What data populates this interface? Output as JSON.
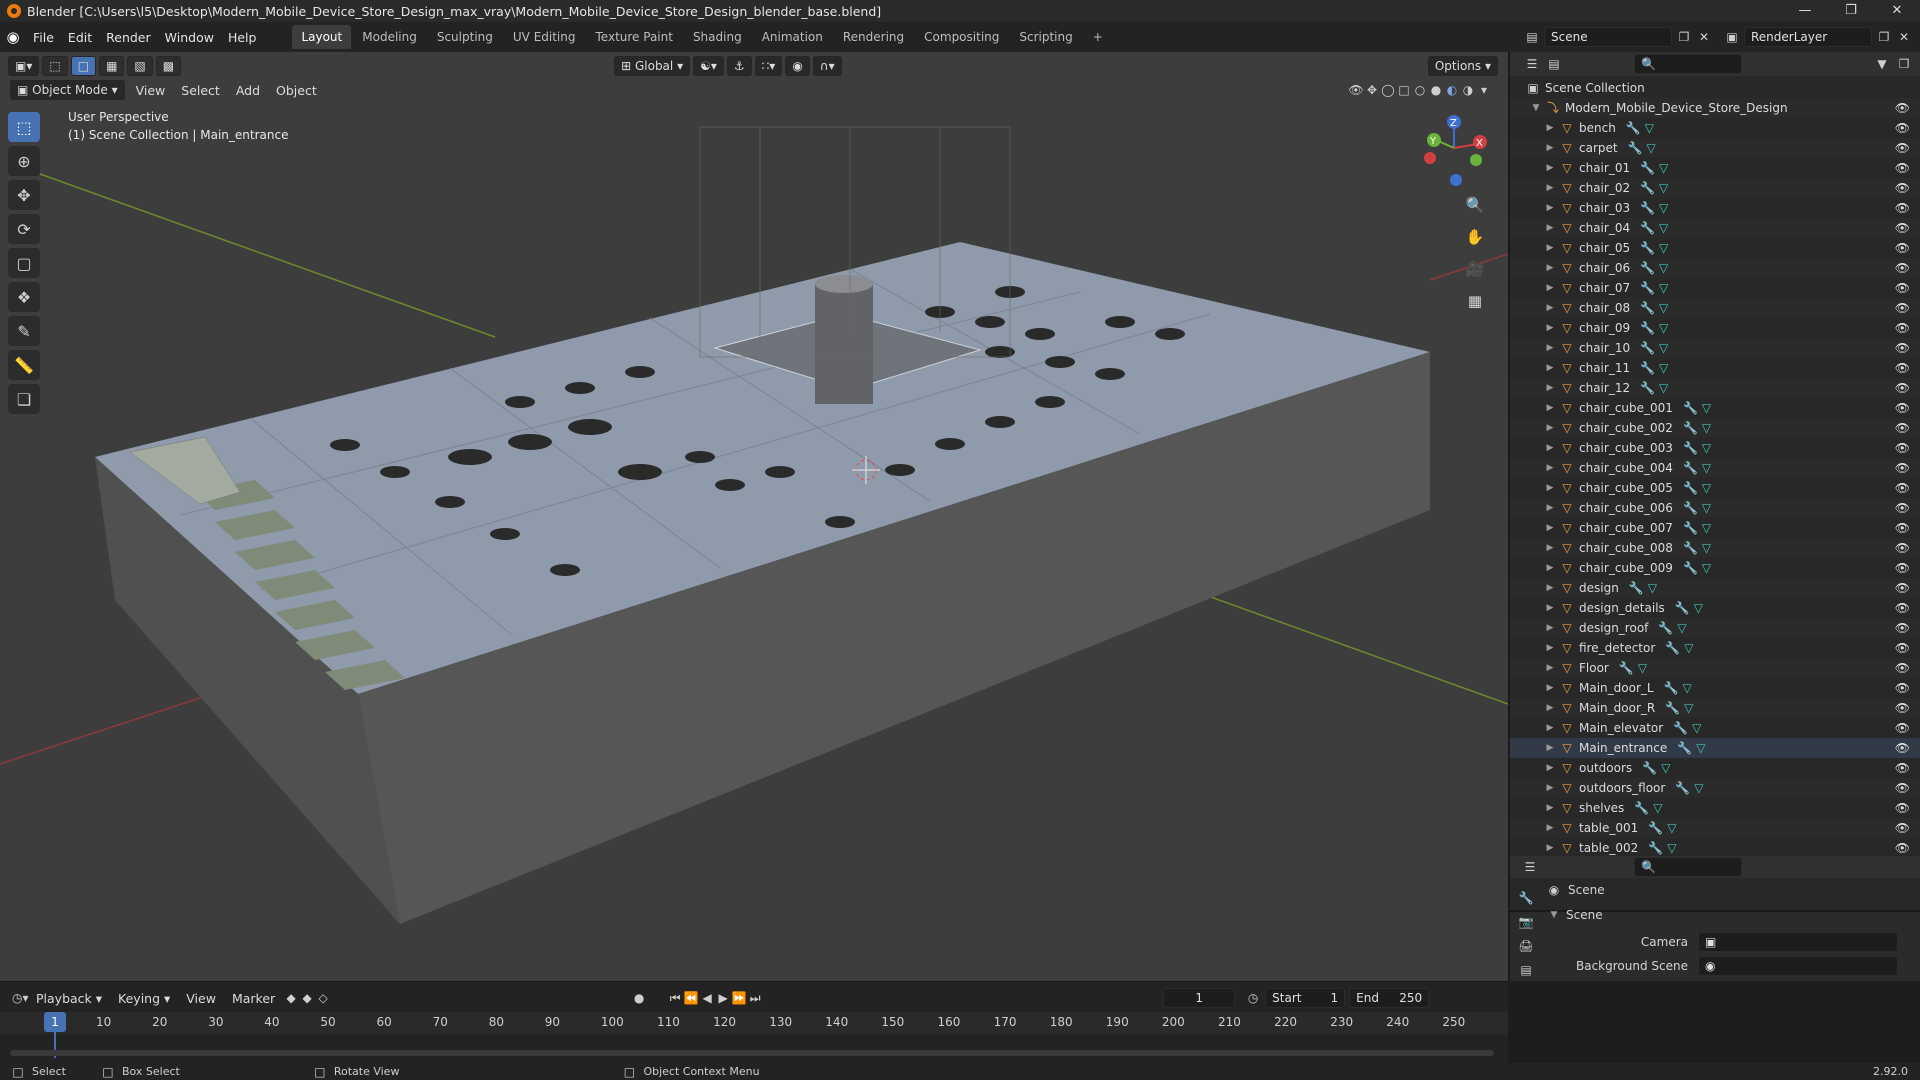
{
  "window": {
    "title": "Blender [C:\\Users\\l5\\Desktop\\Modern_Mobile_Device_Store_Design_max_vray\\Modern_Mobile_Device_Store_Design_blender_base.blend]"
  },
  "menus": [
    "File",
    "Edit",
    "Render",
    "Window",
    "Help"
  ],
  "workspaces": [
    {
      "label": "Layout",
      "active": true
    },
    {
      "label": "Modeling"
    },
    {
      "label": "Sculpting"
    },
    {
      "label": "UV Editing"
    },
    {
      "label": "Texture Paint"
    },
    {
      "label": "Shading"
    },
    {
      "label": "Animation"
    },
    {
      "label": "Rendering"
    },
    {
      "label": "Compositing"
    },
    {
      "label": "Scripting"
    }
  ],
  "scene_field": "Scene",
  "renderlayer_field": "RenderLayer",
  "viewport": {
    "transform_orientation": "Global",
    "options_label": "Options",
    "mode": "Object Mode",
    "header_menus": [
      "View",
      "Select",
      "Add",
      "Object"
    ],
    "perspective_label": "User Perspective",
    "context_label": "(1) Scene Collection | Main_entrance",
    "gizmo": {
      "x": "X",
      "y": "Y",
      "z": "Z"
    }
  },
  "outliner": {
    "root": "Scene Collection",
    "collection": "Modern_Mobile_Device_Store_Design",
    "items": [
      "bench",
      "carpet",
      "chair_01",
      "chair_02",
      "chair_03",
      "chair_04",
      "chair_05",
      "chair_06",
      "chair_07",
      "chair_08",
      "chair_09",
      "chair_10",
      "chair_11",
      "chair_12",
      "chair_cube_001",
      "chair_cube_002",
      "chair_cube_003",
      "chair_cube_004",
      "chair_cube_005",
      "chair_cube_006",
      "chair_cube_007",
      "chair_cube_008",
      "chair_cube_009",
      "design",
      "design_details",
      "design_roof",
      "fire_detector",
      "Floor",
      "Main_door_L",
      "Main_door_R",
      "Main_elevator",
      "Main_entrance",
      "outdoors",
      "outdoors_floor",
      "shelves",
      "table_001",
      "table_002"
    ],
    "selected": "Main_entrance"
  },
  "properties": {
    "scene_label": "Scene",
    "panel_label": "Scene",
    "camera_label": "Camera",
    "background_label": "Background Scene",
    "version": "2.92.0"
  },
  "timeline": {
    "menus": [
      "Playback",
      "Keying",
      "View",
      "Marker"
    ],
    "current_frame": "1",
    "start_label": "Start",
    "start_value": "1",
    "end_label": "End",
    "end_value": "250",
    "ticks": [
      "10",
      "20",
      "30",
      "40",
      "50",
      "60",
      "70",
      "80",
      "90",
      "100",
      "110",
      "120",
      "130",
      "140",
      "150",
      "160",
      "170",
      "180",
      "190",
      "200",
      "210",
      "220",
      "230",
      "240",
      "250"
    ]
  },
  "status": {
    "select": "Select",
    "box_select": "Box Select",
    "rotate_view": "Rotate View",
    "context_menu": "Object Context Menu"
  }
}
